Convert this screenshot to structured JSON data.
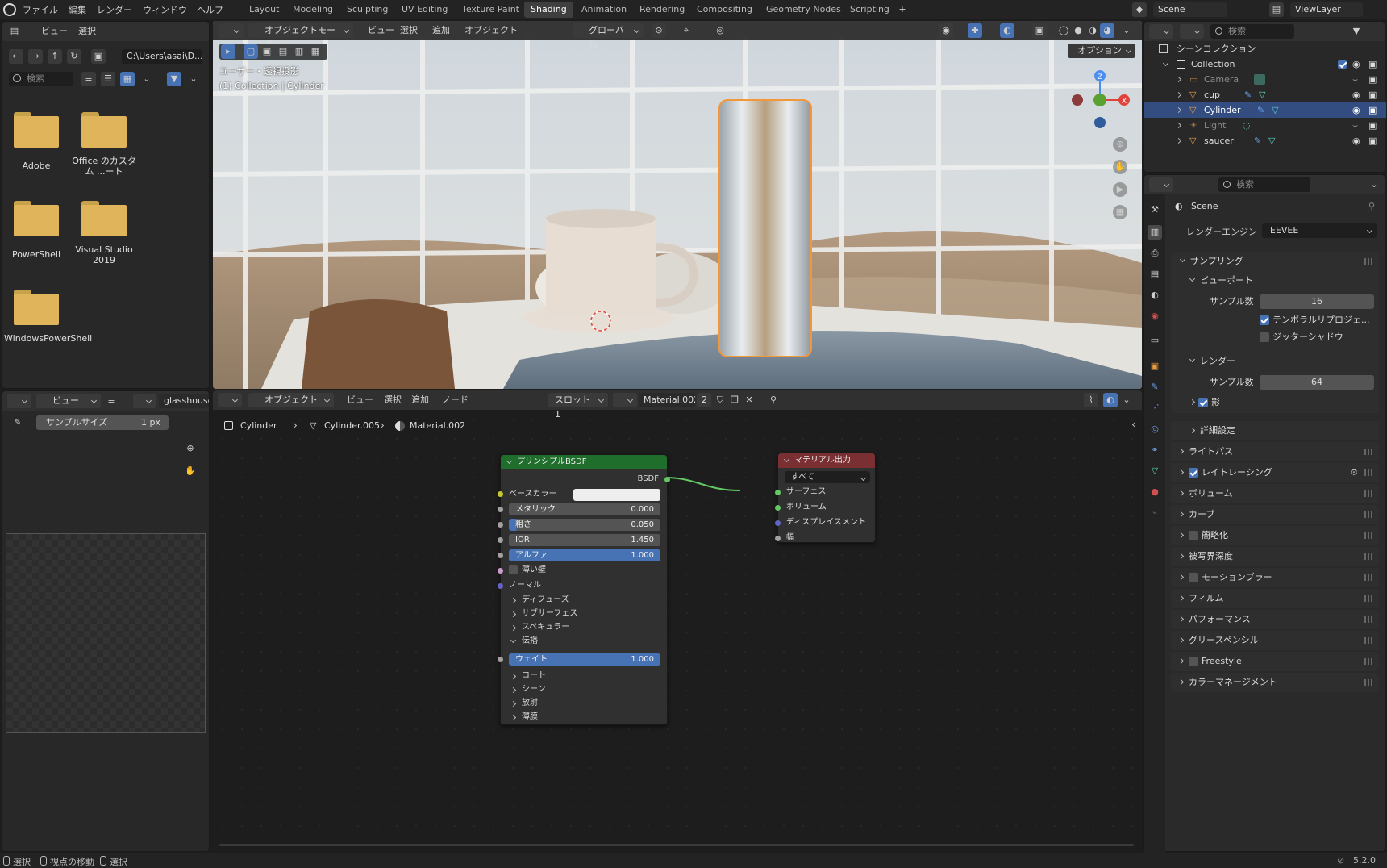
{
  "topbar": {
    "menus": [
      "ファイル",
      "編集",
      "レンダー",
      "ウィンドウ",
      "ヘルプ"
    ],
    "tabs": [
      "Layout",
      "Modeling",
      "Sculpting",
      "UV Editing",
      "Texture Paint",
      "Shading",
      "Animation",
      "Rendering",
      "Compositing",
      "Geometry Nodes",
      "Scripting"
    ],
    "active_tab": "Shading",
    "scene": "Scene",
    "view_layer": "ViewLayer"
  },
  "filebrowser": {
    "menus": [
      "ビュー",
      "選択"
    ],
    "path": "C:\\Users\\asai\\D...",
    "search_placeholder": "検索",
    "folders": [
      {
        "name": "Adobe"
      },
      {
        "name": "Office のカスタム ...ート"
      },
      {
        "name": "PowerShell"
      },
      {
        "name": "Visual Studio 2019"
      },
      {
        "name": "WindowsPowerShell"
      }
    ]
  },
  "viewport": {
    "mode": "オブジェクトモード",
    "menus": [
      "ビュー",
      "選択",
      "追加",
      "オブジェクト"
    ],
    "transform": "グローバル",
    "options": "オプション",
    "overlay_line1": "ユーザー・透視投影",
    "overlay_line2": "(1) Collection | Cylinder",
    "gizmo": {
      "z": "Z",
      "x": "X"
    }
  },
  "imageeditor": {
    "view": "ビュー",
    "image_name": "glasshouse",
    "sample_label": "サンプルサイズ",
    "sample_value": "1 px"
  },
  "nodeeditor": {
    "mode": "オブジェクト",
    "menus": [
      "ビュー",
      "選択",
      "追加",
      "ノード"
    ],
    "slot": "スロット1",
    "material": "Material.002",
    "users": "2",
    "breadcrumb": [
      "Cylinder",
      "Cylinder.005",
      "Material.002"
    ],
    "bsdf": {
      "title": "プリンシプルBSDF",
      "output": "BSDF",
      "base_color": "ベースカラー",
      "fields": [
        {
          "label": "メタリック",
          "value": "0.000"
        },
        {
          "label": "粗さ",
          "value": "0.050"
        },
        {
          "label": "IOR",
          "value": "1.450"
        },
        {
          "label": "アルファ",
          "value": "1.000"
        }
      ],
      "thin_wall": "薄い壁",
      "normal": "ノーマル",
      "sections1": [
        "ディフューズ",
        "サブサーフェス",
        "スペキュラー"
      ],
      "transmission": "伝播",
      "weight_label": "ウェイト",
      "weight_value": "1.000",
      "sections2": [
        "コート",
        "シーン",
        "放射",
        "薄膜"
      ]
    },
    "output": {
      "title": "マテリアル出力",
      "target": "すべて",
      "inputs": [
        "サーフェス",
        "ボリューム",
        "ディスプレイスメント",
        "幅"
      ]
    }
  },
  "outliner": {
    "search_placeholder": "検索",
    "root": "シーンコレクション",
    "collection": "Collection",
    "items": [
      "Camera",
      "cup",
      "Cylinder",
      "Light",
      "saucer"
    ],
    "selected": "Cylinder"
  },
  "properties": {
    "search_placeholder": "検索",
    "scene": "Scene",
    "engine_label": "レンダーエンジン",
    "engine_value": "EEVEE",
    "sampling": "サンプリング",
    "viewport": "ビューポート",
    "sample_label": "サンプル数",
    "viewport_samples": "16",
    "temporal": "テンポラルリプロジェ...",
    "jitter": "ジッターシャドウ",
    "render": "レンダー",
    "render_samples": "64",
    "shadow": "影",
    "advanced": "詳細設定",
    "sections": [
      "ライトパス",
      "レイトレーシング",
      "ボリューム",
      "カーブ",
      "簡略化",
      "被写界深度",
      "モーションブラー",
      "フィルム",
      "パフォーマンス",
      "グリースペンシル",
      "Freestyle",
      "カラーマネージメント"
    ]
  },
  "statusbar": {
    "items": [
      "選択",
      "視点の移動",
      "選択"
    ],
    "version": "5.2.0"
  },
  "colors": {
    "accent": "#4772b3",
    "node_green": "#1f6e2c",
    "node_red": "#7a2f33",
    "selection": "#f2983b"
  }
}
